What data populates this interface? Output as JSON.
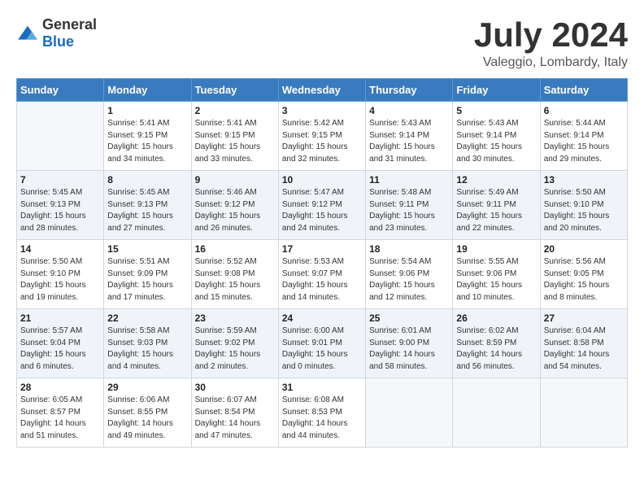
{
  "header": {
    "logo_general": "General",
    "logo_blue": "Blue",
    "month": "July 2024",
    "location": "Valeggio, Lombardy, Italy"
  },
  "weekdays": [
    "Sunday",
    "Monday",
    "Tuesday",
    "Wednesday",
    "Thursday",
    "Friday",
    "Saturday"
  ],
  "weeks": [
    [
      {
        "day": "",
        "empty": true
      },
      {
        "day": "1",
        "sunrise": "5:41 AM",
        "sunset": "9:15 PM",
        "daylight": "15 hours and 34 minutes."
      },
      {
        "day": "2",
        "sunrise": "5:41 AM",
        "sunset": "9:15 PM",
        "daylight": "15 hours and 33 minutes."
      },
      {
        "day": "3",
        "sunrise": "5:42 AM",
        "sunset": "9:15 PM",
        "daylight": "15 hours and 32 minutes."
      },
      {
        "day": "4",
        "sunrise": "5:43 AM",
        "sunset": "9:14 PM",
        "daylight": "15 hours and 31 minutes."
      },
      {
        "day": "5",
        "sunrise": "5:43 AM",
        "sunset": "9:14 PM",
        "daylight": "15 hours and 30 minutes."
      },
      {
        "day": "6",
        "sunrise": "5:44 AM",
        "sunset": "9:14 PM",
        "daylight": "15 hours and 29 minutes."
      }
    ],
    [
      {
        "day": "7",
        "sunrise": "5:45 AM",
        "sunset": "9:13 PM",
        "daylight": "15 hours and 28 minutes."
      },
      {
        "day": "8",
        "sunrise": "5:45 AM",
        "sunset": "9:13 PM",
        "daylight": "15 hours and 27 minutes."
      },
      {
        "day": "9",
        "sunrise": "5:46 AM",
        "sunset": "9:12 PM",
        "daylight": "15 hours and 26 minutes."
      },
      {
        "day": "10",
        "sunrise": "5:47 AM",
        "sunset": "9:12 PM",
        "daylight": "15 hours and 24 minutes."
      },
      {
        "day": "11",
        "sunrise": "5:48 AM",
        "sunset": "9:11 PM",
        "daylight": "15 hours and 23 minutes."
      },
      {
        "day": "12",
        "sunrise": "5:49 AM",
        "sunset": "9:11 PM",
        "daylight": "15 hours and 22 minutes."
      },
      {
        "day": "13",
        "sunrise": "5:50 AM",
        "sunset": "9:10 PM",
        "daylight": "15 hours and 20 minutes."
      }
    ],
    [
      {
        "day": "14",
        "sunrise": "5:50 AM",
        "sunset": "9:10 PM",
        "daylight": "15 hours and 19 minutes."
      },
      {
        "day": "15",
        "sunrise": "5:51 AM",
        "sunset": "9:09 PM",
        "daylight": "15 hours and 17 minutes."
      },
      {
        "day": "16",
        "sunrise": "5:52 AM",
        "sunset": "9:08 PM",
        "daylight": "15 hours and 15 minutes."
      },
      {
        "day": "17",
        "sunrise": "5:53 AM",
        "sunset": "9:07 PM",
        "daylight": "15 hours and 14 minutes."
      },
      {
        "day": "18",
        "sunrise": "5:54 AM",
        "sunset": "9:06 PM",
        "daylight": "15 hours and 12 minutes."
      },
      {
        "day": "19",
        "sunrise": "5:55 AM",
        "sunset": "9:06 PM",
        "daylight": "15 hours and 10 minutes."
      },
      {
        "day": "20",
        "sunrise": "5:56 AM",
        "sunset": "9:05 PM",
        "daylight": "15 hours and 8 minutes."
      }
    ],
    [
      {
        "day": "21",
        "sunrise": "5:57 AM",
        "sunset": "9:04 PM",
        "daylight": "15 hours and 6 minutes."
      },
      {
        "day": "22",
        "sunrise": "5:58 AM",
        "sunset": "9:03 PM",
        "daylight": "15 hours and 4 minutes."
      },
      {
        "day": "23",
        "sunrise": "5:59 AM",
        "sunset": "9:02 PM",
        "daylight": "15 hours and 2 minutes."
      },
      {
        "day": "24",
        "sunrise": "6:00 AM",
        "sunset": "9:01 PM",
        "daylight": "15 hours and 0 minutes."
      },
      {
        "day": "25",
        "sunrise": "6:01 AM",
        "sunset": "9:00 PM",
        "daylight": "14 hours and 58 minutes."
      },
      {
        "day": "26",
        "sunrise": "6:02 AM",
        "sunset": "8:59 PM",
        "daylight": "14 hours and 56 minutes."
      },
      {
        "day": "27",
        "sunrise": "6:04 AM",
        "sunset": "8:58 PM",
        "daylight": "14 hours and 54 minutes."
      }
    ],
    [
      {
        "day": "28",
        "sunrise": "6:05 AM",
        "sunset": "8:57 PM",
        "daylight": "14 hours and 51 minutes."
      },
      {
        "day": "29",
        "sunrise": "6:06 AM",
        "sunset": "8:55 PM",
        "daylight": "14 hours and 49 minutes."
      },
      {
        "day": "30",
        "sunrise": "6:07 AM",
        "sunset": "8:54 PM",
        "daylight": "14 hours and 47 minutes."
      },
      {
        "day": "31",
        "sunrise": "6:08 AM",
        "sunset": "8:53 PM",
        "daylight": "14 hours and 44 minutes."
      },
      {
        "day": "",
        "empty": true
      },
      {
        "day": "",
        "empty": true
      },
      {
        "day": "",
        "empty": true
      }
    ]
  ],
  "labels": {
    "sunrise": "Sunrise:",
    "sunset": "Sunset:",
    "daylight": "Daylight:"
  }
}
